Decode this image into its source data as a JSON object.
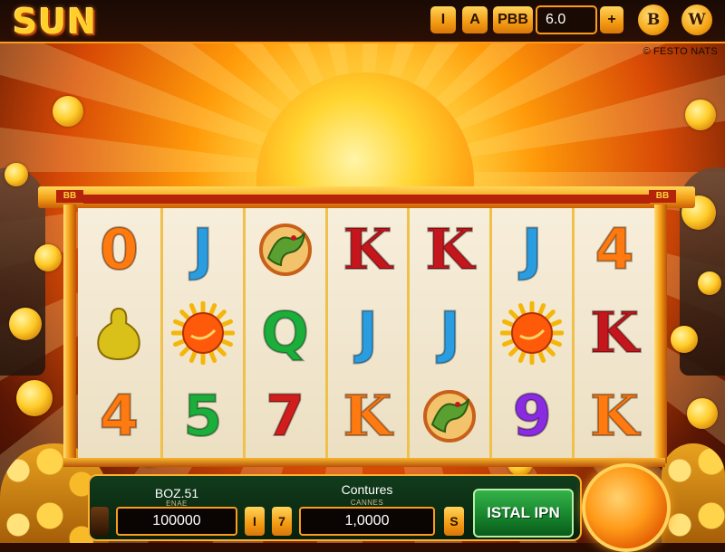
{
  "header": {
    "logo": "SUN",
    "buttons": [
      "I",
      "A",
      "PBB"
    ],
    "display_value": "6.0",
    "plus_label": "+",
    "round_buttons": [
      "B",
      "W"
    ],
    "corner_icon": "copyright-icon",
    "corner_label": "FESTO NATS"
  },
  "frame": {
    "left_tag": "BB",
    "right_tag": "BB"
  },
  "reels": [
    [
      {
        "s": "0",
        "c": "#ff7a10"
      },
      {
        "s": "pear",
        "c": "#d9c11a"
      },
      {
        "s": "4",
        "c": "#ff7a10"
      }
    ],
    [
      {
        "s": "J",
        "c": "#2a9de0"
      },
      {
        "s": "sun",
        "c": "#ff5a0a"
      },
      {
        "s": "5",
        "c": "#1cae3a"
      }
    ],
    [
      {
        "s": "dragon",
        "c": "#5aa030"
      },
      {
        "s": "Q",
        "c": "#1cae3a"
      },
      {
        "s": "7",
        "c": "#d21d1d"
      }
    ],
    [
      {
        "s": "K",
        "c": "#c4161c"
      },
      {
        "s": "J",
        "c": "#2a9de0"
      },
      {
        "s": "K",
        "c": "#ff7a10"
      }
    ],
    [
      {
        "s": "K",
        "c": "#c4161c"
      },
      {
        "s": "J",
        "c": "#2a9de0"
      },
      {
        "s": "dragon",
        "c": "#5aa030"
      }
    ],
    [
      {
        "s": "J",
        "c": "#2a9de0"
      },
      {
        "s": "sun",
        "c": "#ff5a0a"
      },
      {
        "s": "9",
        "c": "#8a2be2"
      }
    ],
    [
      {
        "s": "4",
        "c": "#ff7a10"
      },
      {
        "s": "K",
        "c": "#c4161c"
      },
      {
        "s": "K",
        "c": "#ff7a10"
      }
    ]
  ],
  "panel": {
    "balance_label": "BOZ.51",
    "balance_sub": "ENAE",
    "balance_value": "100000",
    "btn_left": "I",
    "btn_mid": "7",
    "bet_label": "Contures",
    "bet_sub": "CANNES",
    "bet_value": "1,0000",
    "btn_s": "S",
    "install_label": "ISTAL IPN"
  },
  "colors": {
    "accent_orange": "#ff9b1a",
    "panel_green": "#123c1c",
    "install_green": "#15822b"
  }
}
